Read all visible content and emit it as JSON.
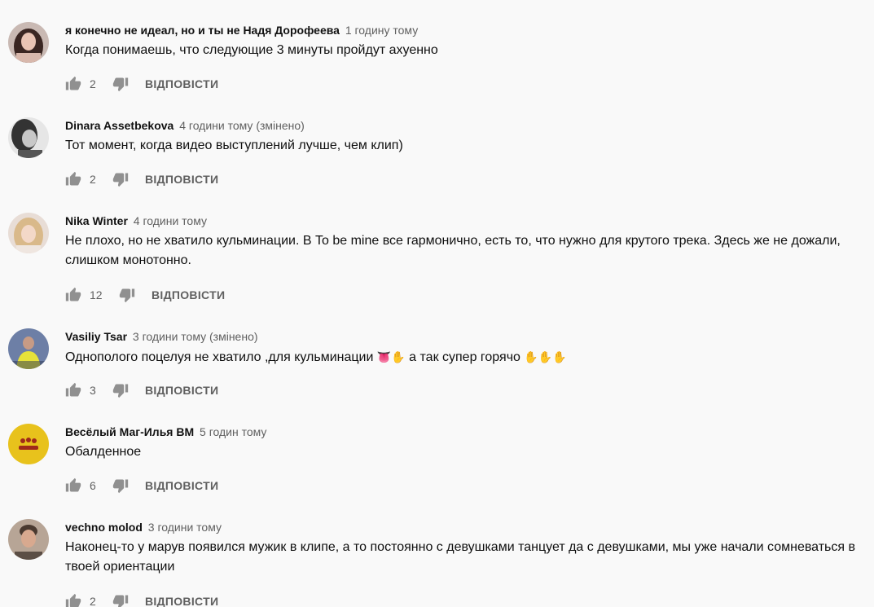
{
  "comments": [
    {
      "author": "я конечно не идеал, но и ты не Надя Дорофеева",
      "time": "1 годину тому",
      "text": "Когда понимаешь, что следующие 3 минуты пройдут ахуенно",
      "likes": "2",
      "reply": "ВІДПОВІСТИ",
      "avatar_icon": "girl-dark-hair-avatar"
    },
    {
      "author": "Dinara Assetbekova",
      "time": "4 години тому (змінено)",
      "text": "Тот момент, когда видео выступлений лучше, чем клип)",
      "likes": "2",
      "reply": "ВІДПОВІСТИ",
      "avatar_icon": "grayscale-girl-avatar"
    },
    {
      "author": "Nika Winter",
      "time": "4 години тому",
      "text": "Не плохо, но не хватило кульминации. В To be mine все гармонично, есть то, что нужно для крутого трека. Здесь же не дожали, слишком монотонно.",
      "likes": "12",
      "reply": "ВІДПОВІСТИ",
      "avatar_icon": "blonde-girl-avatar"
    },
    {
      "author": "Vasiliy Tsar",
      "time": "3 години тому (змінено)",
      "text_before": "Однополого поцелуя не хватило ,для кульминации ",
      "emoji_1": "👅✋",
      "text_middle": " а так супер горячо ",
      "emoji_2": "✋✋✋",
      "likes": "3",
      "reply": "ВІДПОВІСТИ",
      "avatar_icon": "guy-yellow-hoodie-avatar"
    },
    {
      "author": "Весёлый Маг-Илья BM",
      "time": "5 годин тому",
      "text": "Обалденное",
      "likes": "6",
      "reply": "ВІДПОВІСТИ",
      "avatar_icon": "yellow-logo-avatar"
    },
    {
      "author": "vechno molod",
      "time": "3 години тому",
      "text": "Наконец-то у марув появился мужик в клипе, а то постоянно с девушками танцует да с девушками, мы уже начали сомневаться в твоей ориентации",
      "likes": "2",
      "reply": "ВІДПОВІСТИ",
      "avatar_icon": "young-man-avatar"
    }
  ],
  "colors": {
    "background": "#f9f9f9",
    "secondary_text": "#606060",
    "primary_text": "#0f0f0f",
    "icon": "#909090"
  }
}
